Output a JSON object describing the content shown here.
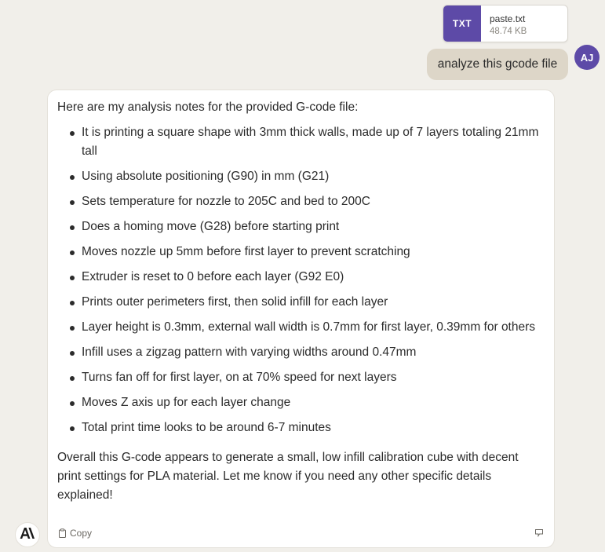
{
  "attachment": {
    "type_label": "TXT",
    "file_name": "paste.txt",
    "file_size": "48.74 KB",
    "accent_color": "#5d4aa7"
  },
  "user": {
    "message": "analyze this gcode file",
    "avatar_initials": "AJ"
  },
  "assistant": {
    "intro": "Here are my analysis notes for the provided G-code file:",
    "notes": [
      "It is printing a square shape with 3mm thick walls, made up of 7 layers totaling 21mm tall",
      "Using absolute positioning (G90) in mm (G21)",
      "Sets temperature for nozzle to 205C and bed to 200C",
      "Does a homing move (G28) before starting print",
      "Moves nozzle up 5mm before first layer to prevent scratching",
      "Extruder is reset to 0 before each layer (G92 E0)",
      "Prints outer perimeters first, then solid infill for each layer",
      "Layer height is 0.3mm, external wall width is 0.7mm for first layer, 0.39mm for others",
      "Infill uses a zigzag pattern with varying widths around 0.47mm",
      "Turns fan off for first layer, on at 70% speed for next layers",
      "Moves Z axis up for each layer change",
      "Total print time looks to be around 6-7 minutes"
    ],
    "summary": "Overall this G-code appears to generate a small, low infill calibration cube with decent print settings for PLA material. Let me know if you need any other specific details explained!",
    "copy_label": "Copy"
  }
}
